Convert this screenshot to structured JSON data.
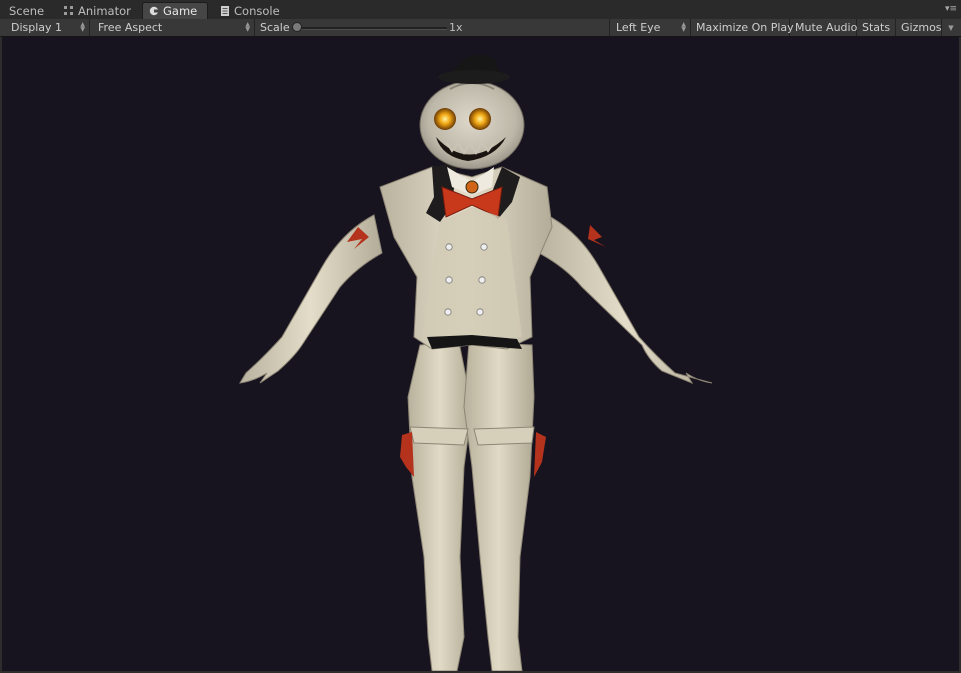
{
  "tabs": [
    {
      "label": "Scene",
      "icon": "scene-icon"
    },
    {
      "label": "Animator",
      "icon": "animator-icon"
    },
    {
      "label": "Game",
      "icon": "game-controller-icon",
      "active": true
    },
    {
      "label": "Console",
      "icon": "console-icon"
    }
  ],
  "toolbar": {
    "display": "Display 1",
    "aspect": "Free Aspect",
    "scale_label": "Scale",
    "scale_value": "1x",
    "eye": "Left Eye",
    "maximize": "Maximize On Play",
    "mute": "Mute Audio",
    "stats": "Stats",
    "gizmos": "Gizmos"
  },
  "colors": {
    "viewport_bg": "#17131f",
    "suit": "#d9d2bd",
    "pumpkin": "#c9c4b6",
    "eyes_glow": "#f2a814",
    "bowtie": "#c8391c"
  },
  "viewport": {
    "content": "pumpkin-head-character-t-pose"
  }
}
